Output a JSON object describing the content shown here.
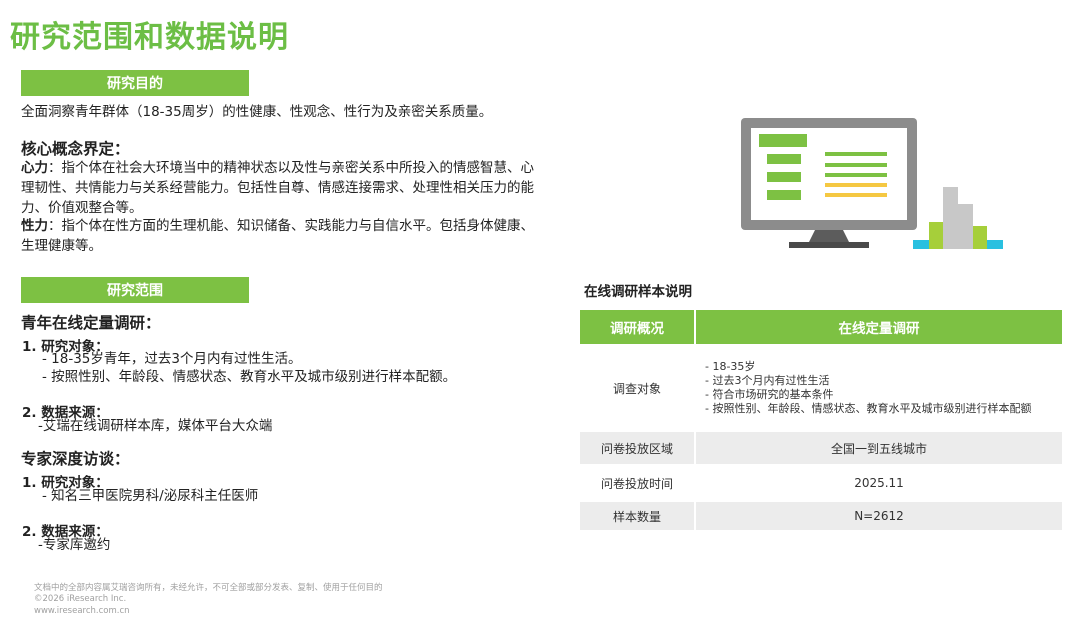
{
  "page_title": "研究范围和数据说明",
  "purpose": {
    "heading": "研究目的",
    "text": "全面洞察青年群体（18-35周岁）的性健康、性观念、性行为及亲密关系质量。"
  },
  "concepts": {
    "heading": "核心概念界定：",
    "xinli_label": "心力",
    "xinli_text": "：指个体在社会大环境当中的精神状态以及性与亲密关系中所投入的情感智慧、心理韧性、共情能力与关系经营能力。包括性自尊、情感连接需求、处理性相关压力的能力、价值观整合等。",
    "xingli_label": "性力",
    "xingli_text": "：指个体在性方面的生理机能、知识储备、实践能力与自信水平。包括身体健康、生理健康等。"
  },
  "scope": {
    "heading": "研究范围",
    "online": {
      "title": "青年在线定量调研：",
      "objects_label": "1.  研究对象：",
      "objects": [
        "- 18-35岁青年，过去3个月内有过性生活。",
        "- 按照性别、年龄段、情感状态、教育水平及城市级别进行样本配额。"
      ],
      "source_label": "2. 数据来源：",
      "source": "-艾瑞在线调研样本库，媒体平台大众端"
    },
    "expert": {
      "title": "专家深度访谈：",
      "objects_label": "1.  研究对象：",
      "objects": [
        "- 知名三甲医院男科/泌尿科主任医师"
      ],
      "source_label": "2. 数据来源：",
      "source": "-专家库邀约"
    }
  },
  "table": {
    "caption": "在线调研样本说明",
    "headers": [
      "调研概况",
      "在线定量调研"
    ],
    "rows": [
      {
        "label": "调查对象",
        "items": [
          "- 18-35岁",
          "- 过去3个月内有过性生活",
          "- 符合市场研究的基本条件",
          "- 按照性别、年龄段、情感状态、教育水平及城市级别进行样本配额"
        ]
      },
      {
        "label": "问卷投放区域",
        "value": "全国一到五线城市"
      },
      {
        "label": "问卷投放时间",
        "value": "2025.11"
      },
      {
        "label": "样本数量",
        "value": "N=2612"
      }
    ]
  },
  "footer": {
    "line1": "文档中的全部内容属艾瑞咨询所有，未经允许，不可全部或部分发表、复制、使用于任何目的",
    "line2": "©2026 iResearch Inc.",
    "line3": "www.iresearch.com.cn"
  },
  "colors": {
    "accent": "#7dc143",
    "title": "#6cbe45",
    "shade": "#ececec"
  },
  "illustration": "monitor-chart-icon"
}
